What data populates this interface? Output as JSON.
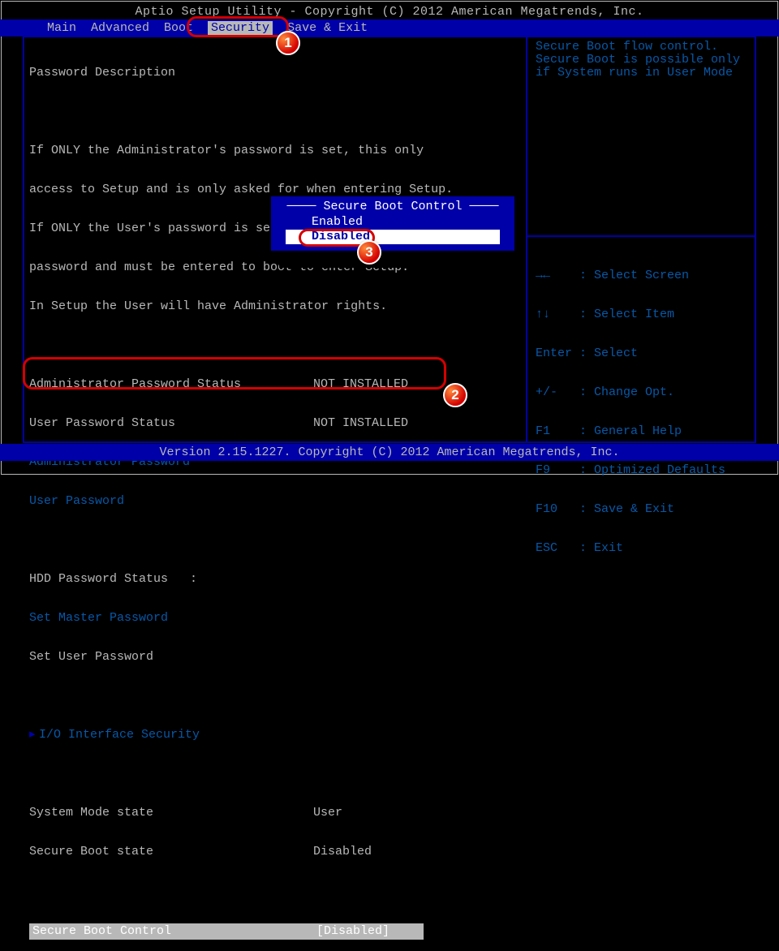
{
  "header": {
    "title": "Aptio Setup Utility - Copyright (C) 2012 American Megatrends, Inc.",
    "tabs": [
      "Main",
      "Advanced",
      "Boot",
      "Security",
      "Save & Exit"
    ],
    "active_tab": "Security"
  },
  "description": {
    "heading": "Password Description",
    "lines": [
      "If ONLY the Administrator's password is set, this only",
      "access to Setup and is only asked for when entering Setup.",
      "If ONLY the User's password is set, this is a power on",
      "password and must be entered to boot to enter Setup.",
      "In Setup the User will have Administrator rights."
    ]
  },
  "items": {
    "admin_pw_status": {
      "label": "Administrator Password Status",
      "value": "NOT INSTALLED"
    },
    "user_pw_status": {
      "label": "User Password Status",
      "value": "NOT INSTALLED"
    },
    "admin_pw": {
      "label": "Administrator Password"
    },
    "user_pw": {
      "label": "User Password"
    },
    "hdd_pw_status": {
      "label": "HDD Password Status   :"
    },
    "set_master_pw": {
      "label": "Set Master Password"
    },
    "set_user_pw": {
      "label": "Set User Password"
    },
    "io_security": {
      "label": "I/O Interface Security"
    },
    "system_mode": {
      "label": "System Mode state",
      "value": "User"
    },
    "secure_boot_state": {
      "label": "Secure Boot state",
      "value": "Disabled"
    },
    "secure_boot_control": {
      "label": "Secure Boot Control",
      "value": "[Disabled]"
    }
  },
  "popup": {
    "title": "Secure Boot Control",
    "options": [
      "Enabled",
      "Disabled"
    ],
    "selected": "Disabled"
  },
  "help": {
    "text": "Secure Boot flow control.\nSecure Boot is possible only if System runs in User Mode"
  },
  "keys": [
    {
      "k": "→←",
      "d": "Select Screen"
    },
    {
      "k": "↑↓",
      "d": "Select Item"
    },
    {
      "k": "Enter",
      "d": "Select"
    },
    {
      "k": "+/-",
      "d": "Change Opt."
    },
    {
      "k": "F1",
      "d": "General Help"
    },
    {
      "k": "F9",
      "d": "Optimized Defaults"
    },
    {
      "k": "F10",
      "d": "Save & Exit"
    },
    {
      "k": "ESC",
      "d": "Exit"
    }
  ],
  "footer": "Version 2.15.1227. Copyright (C) 2012 American Megatrends, Inc.",
  "callouts": {
    "n1": "1",
    "n2": "2",
    "n3": "3"
  }
}
